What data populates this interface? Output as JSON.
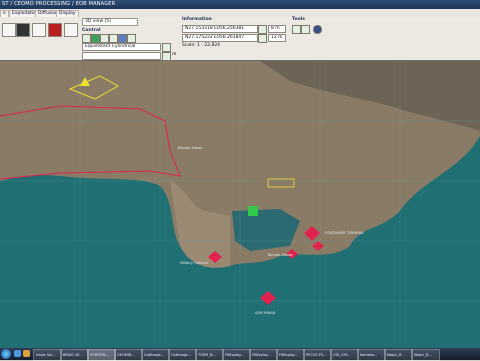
{
  "window": {
    "title": "ST / CEOMO PROCESSING / EOB MANAGER"
  },
  "menu_tabs": [
    {
      "label": "e"
    },
    {
      "label": "Exploitation"
    },
    {
      "label": "Diffusion"
    },
    {
      "label": "Display"
    }
  ],
  "panel": {
    "view_label": "3D view (5)",
    "control": {
      "title": "Control",
      "projection_value": "Equidistant Cylindrical",
      "lat_value": "",
      "x_label": "m"
    },
    "information": {
      "title": "Information",
      "coord_1": "N27.153318 E056.256381",
      "coord_2": "N27.175222 E056.261847",
      "distance_1": "8 m",
      "distance_2": "12 m",
      "scale_label": "Scale: 1 : 22,824"
    },
    "tools": {
      "title": "Tools"
    }
  },
  "map_labels": {
    "label_a": "Bandar Abbas",
    "label_b": "ASM MINAB",
    "label_c": "Bandar Abbas",
    "label_d": "CONTAINER TERMINAL",
    "label_e": "Military Harbour"
  },
  "taskbar": {
    "items": [
      {
        "label": "Inbox Sol..."
      },
      {
        "label": "BRAIG 40..."
      },
      {
        "label": "FORTION..."
      },
      {
        "label": "GEOMIN..."
      },
      {
        "label": "Calibrage..."
      },
      {
        "label": "Calibrage..."
      },
      {
        "label": "TOEM_N..."
      },
      {
        "label": "FK8xplay..."
      },
      {
        "label": "FK8xplay..."
      },
      {
        "label": "FK8xplay..."
      },
      {
        "label": "PECOS FS..."
      },
      {
        "label": "CID_C9F..."
      },
      {
        "label": "Kameka..."
      },
      {
        "label": "Mapic_R..."
      },
      {
        "label": "Mapic_R..."
      }
    ]
  },
  "colors": {
    "sea": "#1f6f73",
    "land": "#8a7b66",
    "accent_red": "#e0234e",
    "accent_yellow": "#f0e030",
    "accent_green": "#34c84a"
  }
}
